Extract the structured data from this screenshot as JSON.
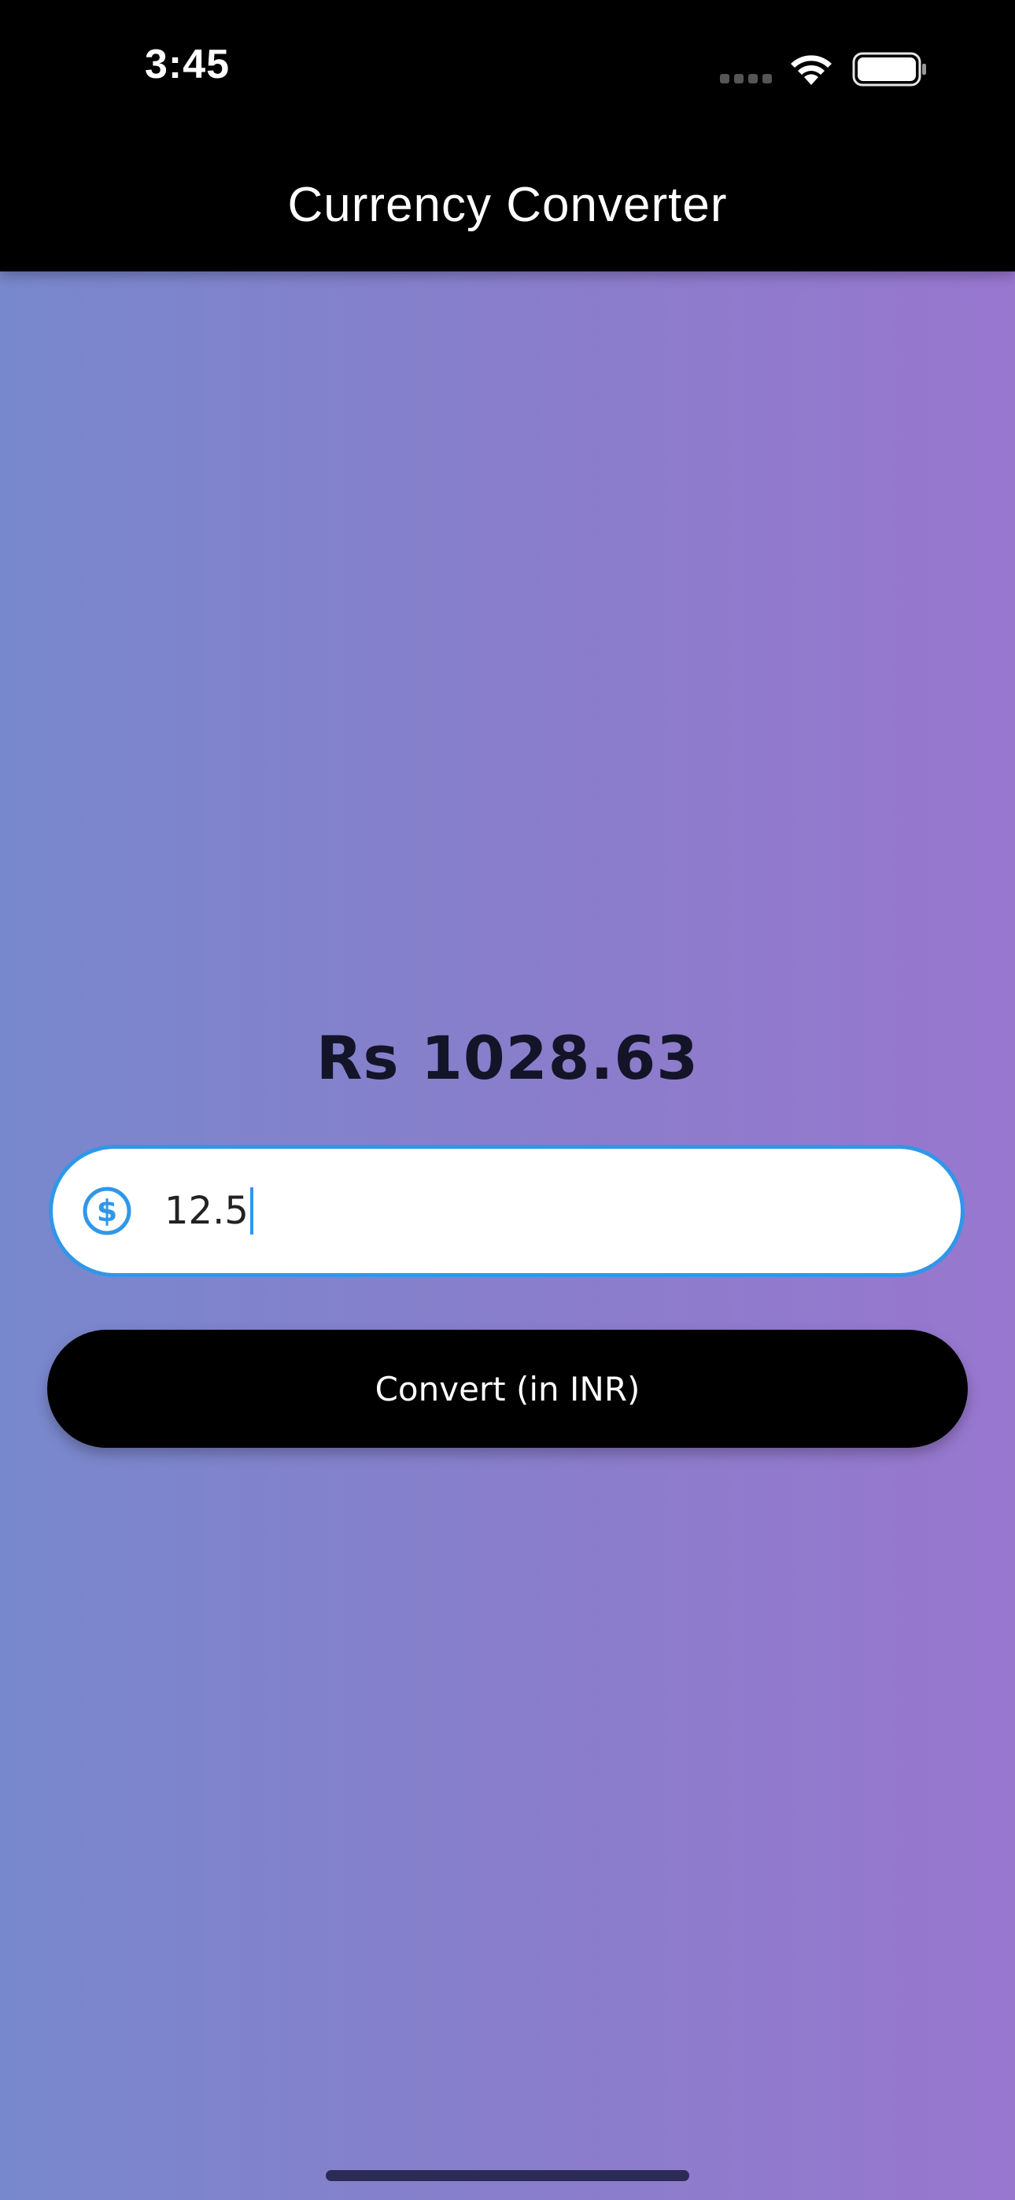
{
  "status_bar": {
    "time": "3:45",
    "icons": [
      "cellular-signal-icon",
      "wifi-icon",
      "battery-icon"
    ]
  },
  "app_bar": {
    "title": "Currency Converter"
  },
  "main": {
    "result_text": "Rs 1028.63",
    "amount_input": {
      "value": "12.5",
      "prefix_icon": "dollar-circle-icon",
      "focused": true
    },
    "convert_button_label": "Convert (in INR)"
  },
  "colors": {
    "accent": "#2f97ea",
    "app_bar_background": "#000000",
    "gradient_start": "#7888cc",
    "gradient_end": "#9877cf",
    "button_background": "#000000",
    "result_text": "#141428"
  }
}
